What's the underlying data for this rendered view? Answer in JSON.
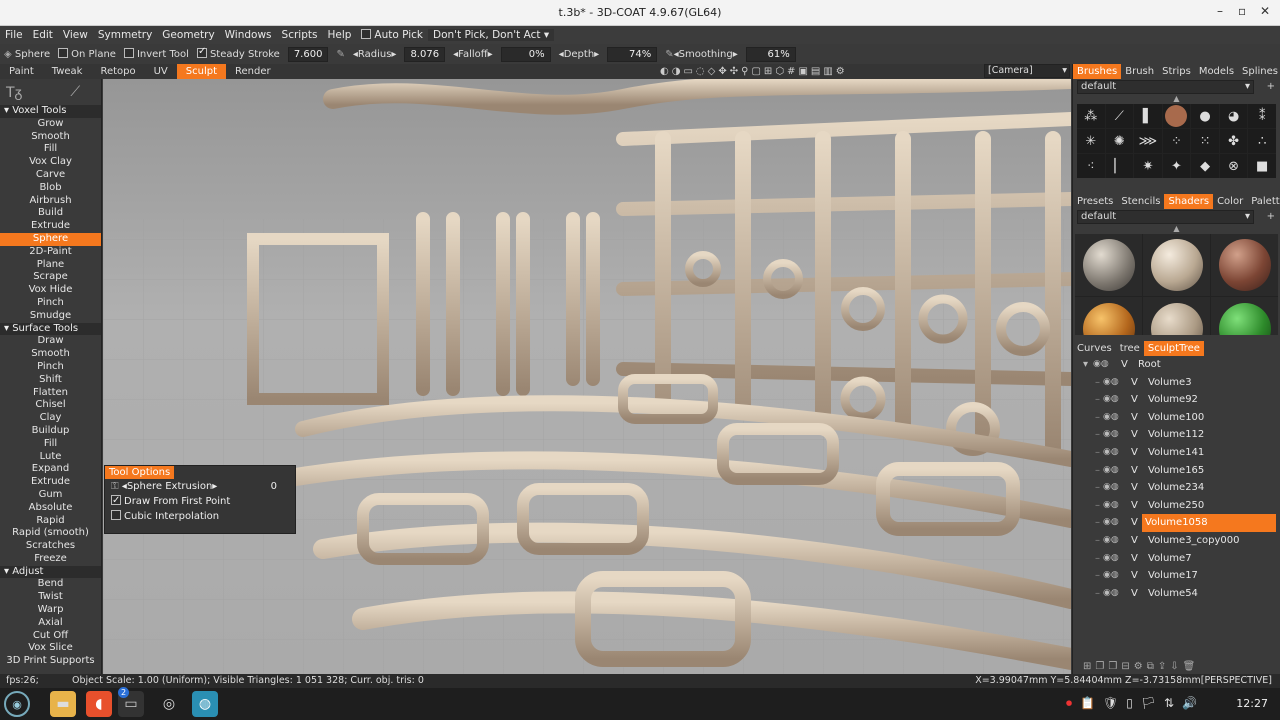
{
  "window": {
    "title": "t.3b* - 3D-COAT 4.9.67(GL64)"
  },
  "menu": [
    "File",
    "Edit",
    "View",
    "Symmetry",
    "Geometry",
    "Windows",
    "Scripts",
    "Help"
  ],
  "menu_extra": {
    "auto_pick": "Auto Pick",
    "dont_pick": "Don't Pick, Don't Act"
  },
  "toolbar": {
    "tool": "Sphere",
    "on_plane": "On Plane",
    "invert_tool": "Invert Tool",
    "steady_stroke": "Steady Stroke",
    "steady_value": "7.600",
    "radius_label": "Radius",
    "radius_value": "8.076",
    "falloff_label": "Falloff",
    "falloff_value": "0%",
    "depth_label": "Depth",
    "depth_value": "74%",
    "smoothing_label": "Smoothing",
    "smoothing_value": "61%"
  },
  "tabs": [
    "Paint",
    "Tweak",
    "Retopo",
    "UV",
    "Sculpt",
    "Render"
  ],
  "active_tab": "Sculpt",
  "camera": "[Camera]",
  "left": {
    "voxel_header": "Voxel Tools",
    "voxel": [
      "Grow",
      "Smooth",
      "Fill",
      "Vox Clay",
      "Carve",
      "Blob",
      "Airbrush",
      "Build",
      "Extrude",
      "Sphere",
      "2D-Paint",
      "Plane",
      "Scrape",
      "Vox Hide",
      "Pinch",
      "Smudge"
    ],
    "surface_header": "Surface Tools",
    "surface": [
      "Draw",
      "Smooth",
      "Pinch",
      "Shift",
      "Flatten",
      "Chisel",
      "Clay",
      "Buildup",
      "Fill",
      "Lute",
      "Expand",
      "Extrude",
      "Gum",
      "Absolute",
      "Rapid",
      "Rapid (smooth)",
      "Scratches",
      "Freeze"
    ],
    "adjust_header": "Adjust",
    "adjust": [
      "Bend",
      "Twist",
      "Warp",
      "Axial",
      "Cut Off",
      "Vox Slice",
      "3D Print Supports"
    ],
    "selected": "Sphere"
  },
  "tool_options": {
    "header": "Tool Options",
    "sphere_extrusion": "Sphere Extrusion",
    "sphere_extrusion_value": "0",
    "draw_from_first": "Draw From First Point",
    "cubic": "Cubic Interpolation"
  },
  "right": {
    "top_tabs": [
      "Brushes",
      "Brush",
      "Strips",
      "Models",
      "Splines"
    ],
    "brush_preset": "default",
    "mid_tabs": [
      "Presets",
      "Stencils",
      "Shaders",
      "Color",
      "Palette"
    ],
    "shader_preset": "default",
    "tree_tabs": [
      "Curves",
      "tree",
      "SculptTree"
    ],
    "tree_root": "Root",
    "tree_items": [
      "Volume3",
      "Volume92",
      "Volume100",
      "Volume112",
      "Volume141",
      "Volume165",
      "Volume234",
      "Volume250",
      "Volume1058",
      "Volume3_copy000",
      "Volume7",
      "Volume17",
      "Volume54"
    ],
    "tree_selected": "Volume1058",
    "tree_marker": "V"
  },
  "status": {
    "fps": "fps:26;",
    "info": "Object Scale: 1.00 (Uniform); Visible Triangles: 1 051 328; Curr. obj. tris: 0",
    "coords": "X=3.99047mm  Y=5.84404mm  Z=-3.73158mm[PERSPECTIVE]"
  },
  "taskbar": {
    "time": "12:27",
    "badge": "2"
  },
  "colors": {
    "accent": "#f5781e",
    "panel": "#3a3a3a",
    "dark": "#2a2a2a"
  }
}
